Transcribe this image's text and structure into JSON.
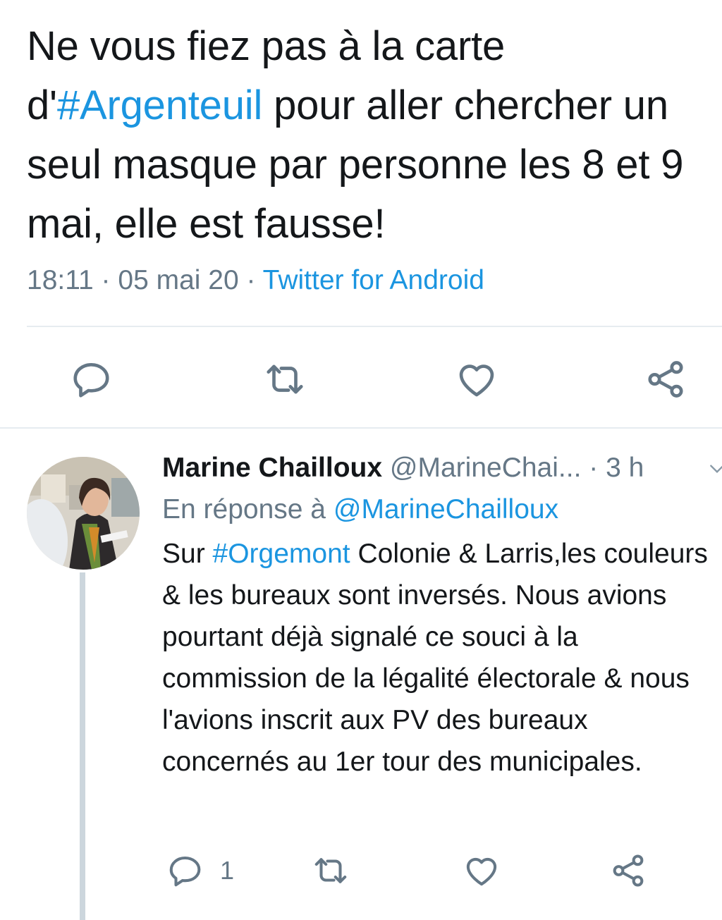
{
  "main_tweet": {
    "text_before": "Ne vous fiez pas à la carte d'",
    "hashtag": "#Argenteuil",
    "text_after": " pour aller chercher un seul masque par personne les 8 et 9 mai, elle est fausse!",
    "time": "18:11",
    "date": "05 mai 20",
    "separator": "·",
    "source": "Twitter for Android"
  },
  "actions": {
    "reply_icon": "speech-bubble-icon",
    "retweet_icon": "retweet-icon",
    "like_icon": "heart-icon",
    "share_icon": "share-icon"
  },
  "reply_tweet": {
    "name": "Marine Chailloux",
    "handle": "@MarineChai...",
    "separator": "·",
    "age": "3 h",
    "in_reply_label": "En réponse à",
    "in_reply_mention": "@MarineChailloux",
    "text_prefix": "Sur ",
    "hashtag": "#Orgemont",
    "text_rest": " Colonie & Larris,les couleurs & les bureaux sont inversés. Nous avions pourtant déjà signalé ce souci à la commission de la légalité électorale & nous l'avions inscrit aux PV des bureaux concernés au 1er tour des municipales.",
    "reply_count": "1"
  },
  "colors": {
    "link": "#1b95e0",
    "secondary_text": "#657786",
    "primary_text": "#14171a",
    "icon": "#657786",
    "divider": "#e6ecf0"
  }
}
